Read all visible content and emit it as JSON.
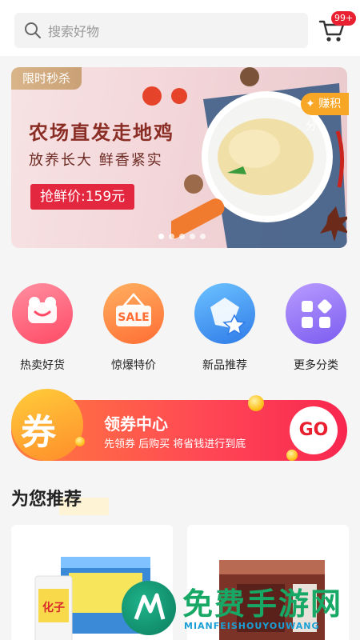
{
  "search": {
    "placeholder": "搜索好物"
  },
  "cart": {
    "badge": "99+"
  },
  "banner": {
    "tag": "限时秒杀",
    "title": "农场直发走地鸡",
    "subtitle": "放养长大 鲜香紧实",
    "price": "抢鲜价:159元",
    "side_tag": "赚积分",
    "dots": 5
  },
  "categories": [
    {
      "label": "热卖好货",
      "icon": "hot-goods-icon",
      "color": "#ff5f73"
    },
    {
      "label": "惊爆特价",
      "icon": "sale-tag-icon",
      "color": "#ff8a3a"
    },
    {
      "label": "新品推荐",
      "icon": "new-product-icon",
      "color": "#3b8ff3"
    },
    {
      "label": "更多分类",
      "icon": "more-categories-icon",
      "color": "#8f6cf1"
    }
  ],
  "coupon": {
    "char": "券",
    "title": "领券中心",
    "subtitle": "先领券 后购买 将省钱进行到底",
    "go": "GO"
  },
  "recommend": {
    "title": "为您推荐"
  },
  "watermark": {
    "text": "免费手游网",
    "sub": "MIANFEISHOUYOUWANG"
  },
  "colors": {
    "accent": "#e8202f",
    "coupon_start": "#ff7b3e",
    "coupon_end": "#f8264f"
  }
}
